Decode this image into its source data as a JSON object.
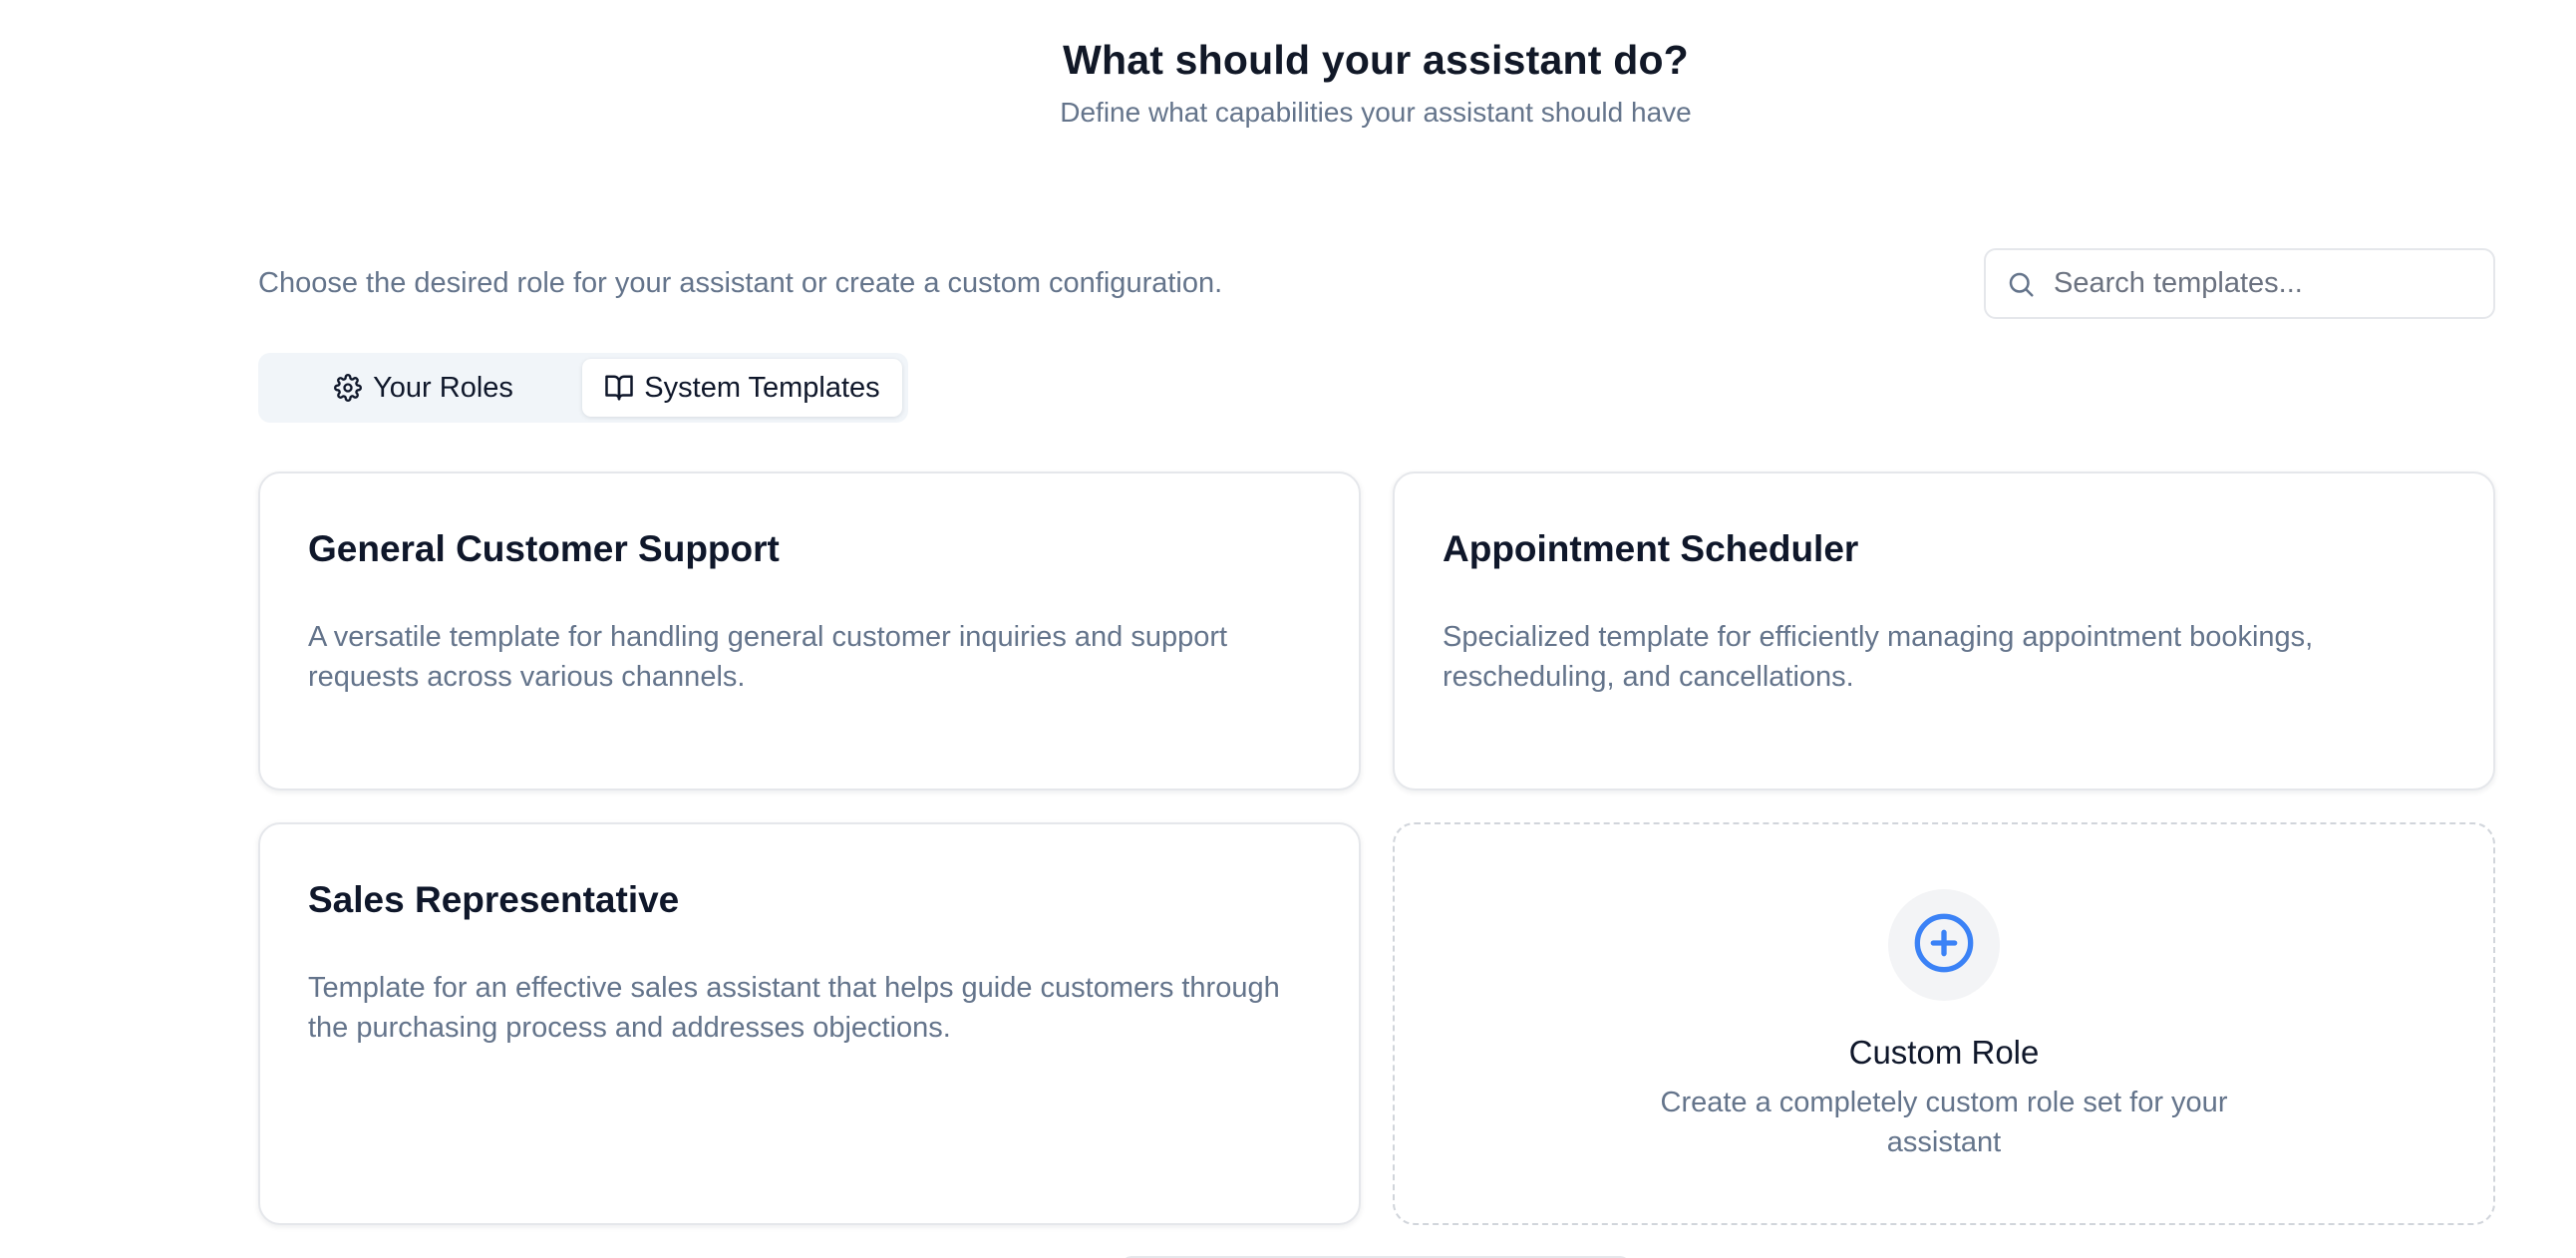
{
  "header": {
    "title": "What should your assistant do?",
    "subtitle": "Define what capabilities your assistant should have"
  },
  "intro": {
    "text": "Choose the desired role for your assistant or create a custom configuration."
  },
  "search": {
    "placeholder": "Search templates...",
    "value": "",
    "icon": "search-icon"
  },
  "tabs": [
    {
      "label": "Your Roles",
      "icon": "gear-icon",
      "active": false
    },
    {
      "label": "System Templates",
      "icon": "book-open-icon",
      "active": true
    }
  ],
  "cards": [
    {
      "title": "General Customer Support",
      "description": "A versatile template for handling general customer inquiries and support requests across various channels."
    },
    {
      "title": "Appointment Scheduler",
      "description": "Specialized template for efficiently managing appointment bookings, rescheduling, and cancellations."
    },
    {
      "title": "Sales Representative",
      "description": "Template for an effective sales assistant that helps guide customers through the purchasing process and addresses objections."
    }
  ],
  "custom_card": {
    "title": "Custom Role",
    "description": "Create a completely custom role set for your assistant",
    "icon": "plus-circle-icon"
  },
  "colors": {
    "accent": "#3b82f6",
    "muted_text": "#64748b",
    "border": "#e5e7eb"
  }
}
